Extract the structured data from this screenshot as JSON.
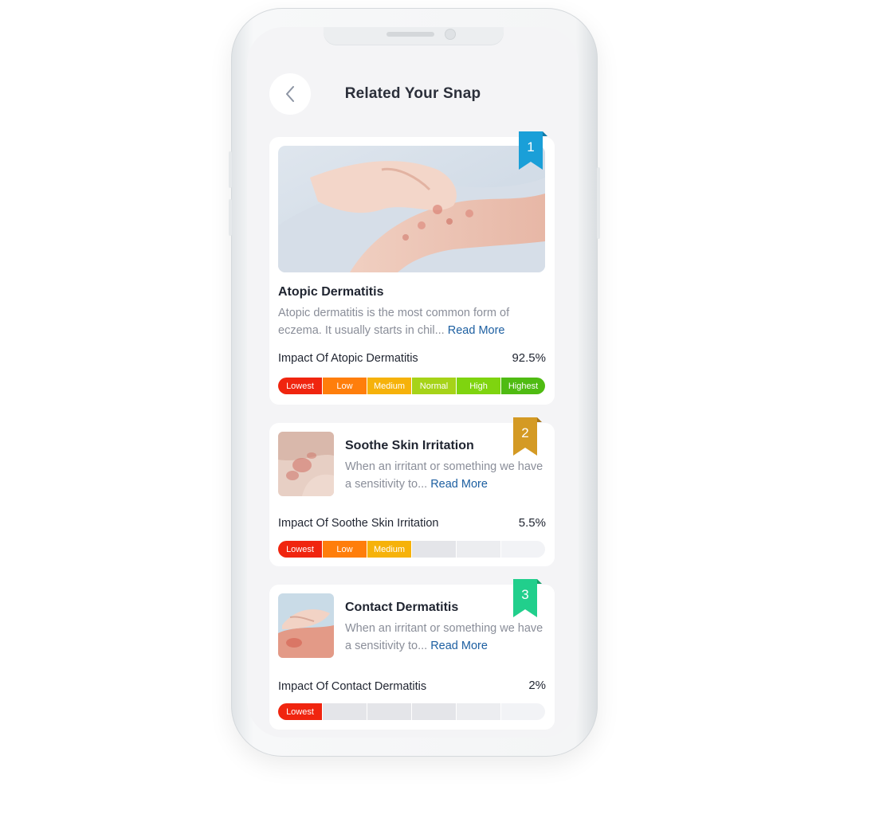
{
  "header": {
    "title": "Related Your Snap"
  },
  "severity_levels": [
    "Lowest",
    "Low",
    "Medium",
    "Normal",
    "High",
    "Highest"
  ],
  "severity_colors": [
    "#f0250f",
    "#ff7e0b",
    "#f6b20a",
    "#a6d318",
    "#7fd40f",
    "#4fbb12"
  ],
  "cards": [
    {
      "rank": "1",
      "rank_color": "#1a9fd8",
      "title": "Atopic Dermatitis",
      "description": "Atopic dermatitis is the most common form of eczema. It usually starts in chil...",
      "read_more": "Read More",
      "impact_label": "Impact Of Atopic Dermatitis",
      "impact_value": "92.5%",
      "filled_segments": 6
    },
    {
      "rank": "2",
      "rank_color": "#d49a24",
      "title": "Soothe Skin Irritation",
      "description": "When an irritant or something we have a sensitivity to...",
      "read_more": "Read More",
      "impact_label": "Impact Of Soothe Skin Irritation",
      "impact_value": "5.5%",
      "filled_segments": 3
    },
    {
      "rank": "3",
      "rank_color": "#21cf8c",
      "title": "Contact Dermatitis",
      "description": "When an irritant or something we have a sensitivity to...",
      "read_more": "Read More",
      "impact_label": "Impact Of Contact Dermatitis",
      "impact_value": "2%",
      "filled_segments": 1
    }
  ]
}
